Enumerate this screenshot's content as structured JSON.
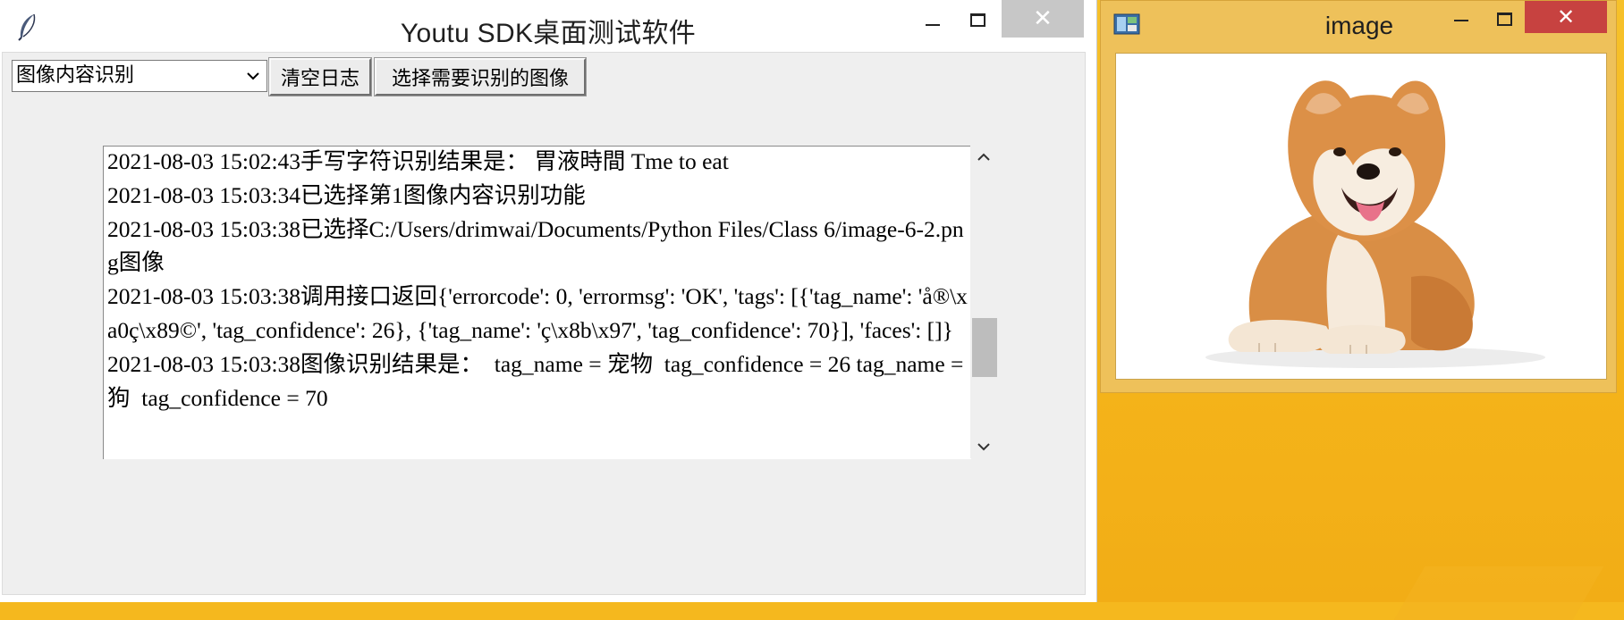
{
  "main_window": {
    "title": "Youtu SDK桌面测试软件",
    "close_symbol": "✕",
    "icons": {
      "app": "feather-icon",
      "minimize": "minimize-icon",
      "maximize": "maximize-icon",
      "close": "close-icon"
    }
  },
  "toolbar": {
    "mode_select_value": "图像内容识别",
    "clear_log_label": "清空日志",
    "choose_image_label": "选择需要识别的图像"
  },
  "log": {
    "text": "2021-08-03 15:02:43手写字符识别结果是： 胃液時間 Tme to eat\n2021-08-03 15:03:34已选择第1图像内容识别功能\n2021-08-03 15:03:38已选择C:/Users/drimwai/Documents/Python Files/Class 6/image-6-2.png图像\n2021-08-03 15:03:38调用接口返回{'errorcode': 0, 'errormsg': 'OK', 'tags': [{'tag_name': 'å®\\xa0ç\\x89©', 'tag_confidence': 26}, {'tag_name': 'ç\\x8b\\x97', 'tag_confidence': 70}], 'faces': []}\n2021-08-03 15:03:38图像识别结果是：  tag_name = 宠物  tag_confidence = 26 tag_name = 狗  tag_confidence = 70"
  },
  "scrollbar": {
    "position_fraction": 0.72
  },
  "image_window": {
    "title": "image",
    "close_symbol": "✕",
    "content": "shiba-inu-dog"
  },
  "colors": {
    "desktop": "#f5b81e",
    "image_window_frame": "#eec15a",
    "image_close": "#c74240",
    "main_close": "#c7c7c7"
  }
}
